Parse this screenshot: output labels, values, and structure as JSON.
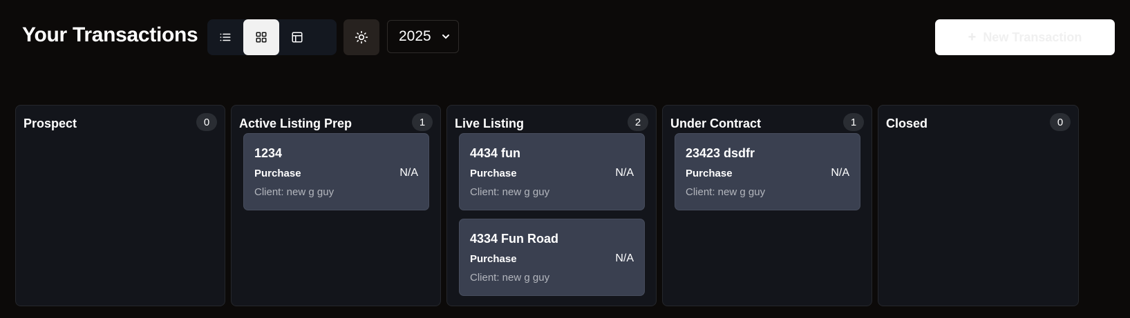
{
  "header": {
    "title": "Your Transactions",
    "year": "2025",
    "new_button_label": "New Transaction",
    "views": [
      {
        "name": "list-view",
        "icon": "list-icon",
        "active": false
      },
      {
        "name": "board-view",
        "icon": "grid-icon",
        "active": true
      },
      {
        "name": "table-view",
        "icon": "table-icon",
        "active": false
      }
    ],
    "theme_icon": "sun-icon"
  },
  "columns": [
    {
      "title": "Prospect",
      "count": "0",
      "cards": []
    },
    {
      "title": "Active Listing Prep",
      "count": "1",
      "cards": [
        {
          "name": "1234",
          "type": "Purchase",
          "amount": "N/A",
          "client": "Client: new g guy"
        }
      ]
    },
    {
      "title": "Live Listing",
      "count": "2",
      "cards": [
        {
          "name": "4434 fun",
          "type": "Purchase",
          "amount": "N/A",
          "client": "Client: new g guy"
        },
        {
          "name": "4334 Fun Road",
          "type": "Purchase",
          "amount": "N/A",
          "client": "Client: new g guy"
        }
      ]
    },
    {
      "title": "Under Contract",
      "count": "1",
      "cards": [
        {
          "name": "23423 dsdfr",
          "type": "Purchase",
          "amount": "N/A",
          "client": "Client: new g guy"
        }
      ]
    },
    {
      "title": "Closed",
      "count": "0",
      "cards": []
    }
  ],
  "colors": {
    "background": "#0c0a09",
    "column": "#13151b",
    "card": "#3a4050",
    "accent": "#ffffff"
  }
}
